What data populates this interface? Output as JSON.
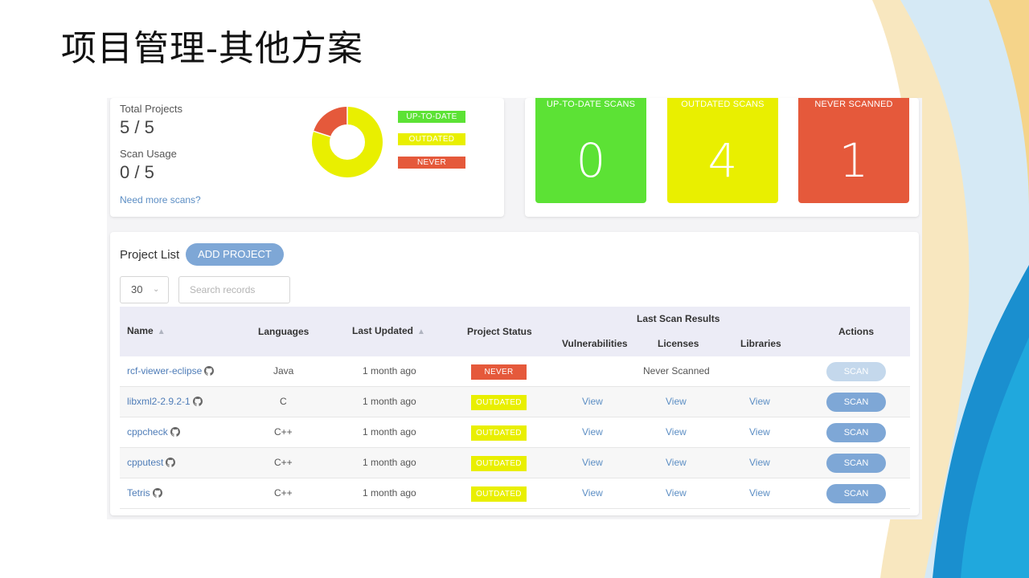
{
  "slide": {
    "title": "项目管理-其他方案"
  },
  "colors": {
    "up_to_date": "#5ce235",
    "outdated": "#e9ef00",
    "never": "#e5593b",
    "accent": "#7ea7d6",
    "link": "#5c8ec4"
  },
  "summary": {
    "total_projects_label": "Total Projects",
    "total_projects_value": "5 / 5",
    "scan_usage_label": "Scan Usage",
    "scan_usage_value": "0 / 5",
    "more_link": "Need more scans?",
    "legend": [
      {
        "label": "UP-TO-DATE",
        "color": "#5ce235"
      },
      {
        "label": "OUTDATED",
        "color": "#e9ef00"
      },
      {
        "label": "NEVER",
        "color": "#e5593b"
      }
    ],
    "donut": [
      {
        "name": "UP-TO-DATE",
        "value": 0,
        "color": "#5ce235"
      },
      {
        "name": "OUTDATED",
        "value": 4,
        "color": "#e9ef00"
      },
      {
        "name": "NEVER",
        "value": 1,
        "color": "#e5593b"
      }
    ]
  },
  "tiles": [
    {
      "label": "UP-TO-DATE SCANS",
      "value": "0",
      "color": "#5ce235"
    },
    {
      "label": "OUTDATED SCANS",
      "value": "4",
      "color": "#e9ef00"
    },
    {
      "label": "NEVER SCANNED",
      "value": "1",
      "color": "#e5593b"
    }
  ],
  "project_list": {
    "title": "Project List",
    "add_button": "ADD PROJECT",
    "page_size": "30",
    "search_placeholder": "Search records",
    "columns": {
      "name": "Name",
      "languages": "Languages",
      "last_updated": "Last Updated",
      "project_status": "Project Status",
      "last_scan_results": "Last Scan Results",
      "vulnerabilities": "Vulnerabilities",
      "licenses": "Licenses",
      "libraries": "Libraries",
      "actions": "Actions"
    },
    "rows": [
      {
        "name": "rcf-viewer-eclipse",
        "language": "Java",
        "updated": "1 month ago",
        "status": "NEVER",
        "never_scanned": "Never Scanned",
        "scan": "SCAN",
        "scan_enabled": false
      },
      {
        "name": "libxml2-2.9.2-1",
        "language": "C",
        "updated": "1 month ago",
        "status": "OUTDATED",
        "vulnerabilities": "View",
        "licenses": "View",
        "libraries": "View",
        "scan": "SCAN",
        "scan_enabled": true
      },
      {
        "name": "cppcheck",
        "language": "C++",
        "updated": "1 month ago",
        "status": "OUTDATED",
        "vulnerabilities": "View",
        "licenses": "View",
        "libraries": "View",
        "scan": "SCAN",
        "scan_enabled": true
      },
      {
        "name": "cpputest",
        "language": "C++",
        "updated": "1 month ago",
        "status": "OUTDATED",
        "vulnerabilities": "View",
        "licenses": "View",
        "libraries": "View",
        "scan": "SCAN",
        "scan_enabled": true
      },
      {
        "name": "Tetris",
        "language": "C++",
        "updated": "1 month ago",
        "status": "OUTDATED",
        "vulnerabilities": "View",
        "licenses": "View",
        "libraries": "View",
        "scan": "SCAN",
        "scan_enabled": true
      }
    ]
  }
}
